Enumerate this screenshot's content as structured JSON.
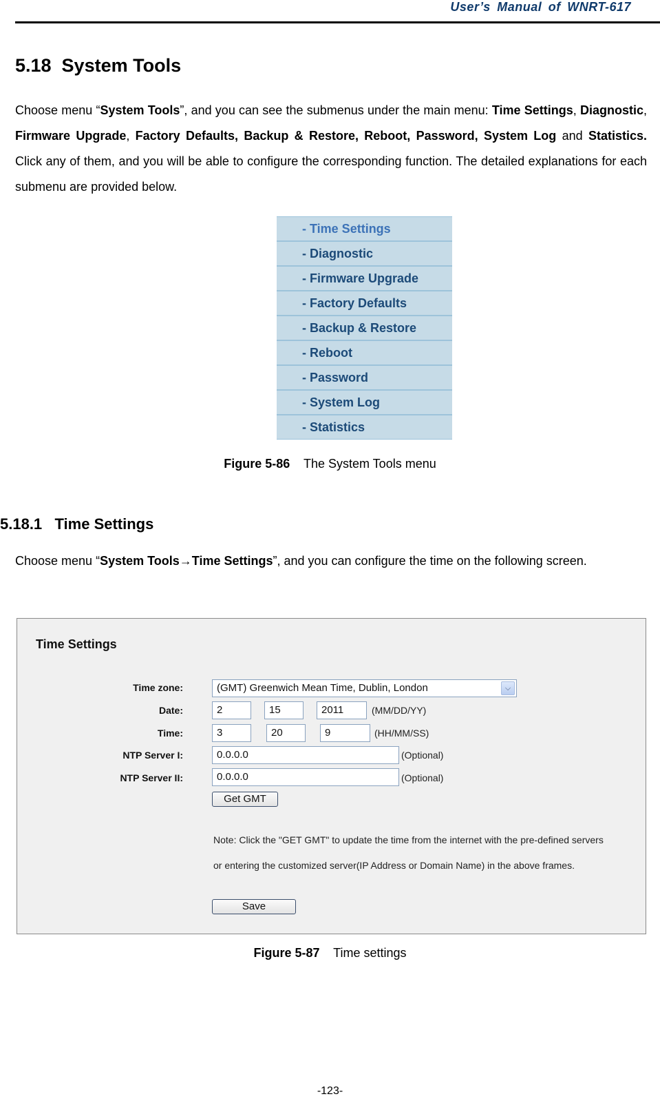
{
  "header": {
    "title": "User’s  Manual  of  WNRT-617"
  },
  "section": {
    "number": "5.18",
    "title": "System Tools",
    "heading": "5.18  System Tools"
  },
  "intro_paragraph": {
    "p1_prefix": "Choose menu “",
    "p1_bold1": "System Tools",
    "p1_mid": "”, and you can see the submenus under the main menu: ",
    "bold_items": [
      "Time Settings",
      "Diagnostic",
      "Firmware Upgrade",
      "Factory Defaults, Backup & Restore, Reboot, Password,",
      "System Log",
      "Statistics."
    ],
    "sep_comma": ", ",
    "and_word": " and ",
    "tail": " Click any of them, and you will be able to configure the corresponding function. The detailed explanations for each submenu are provided below."
  },
  "menu": {
    "items": [
      {
        "label": "- Time Settings",
        "active": true
      },
      {
        "label": "- Diagnostic"
      },
      {
        "label": "- Firmware Upgrade"
      },
      {
        "label": "- Factory Defaults"
      },
      {
        "label": "- Backup & Restore"
      },
      {
        "label": "- Reboot"
      },
      {
        "label": "- Password"
      },
      {
        "label": "- System Log"
      },
      {
        "label": "- Statistics"
      }
    ]
  },
  "figure1": {
    "label": "Figure 5-86",
    "text": "    The System Tools menu"
  },
  "subsection": {
    "heading": "5.18.1   Time Settings"
  },
  "sub_paragraph": {
    "prefix": "Choose  menu  “",
    "bold": "System Tools→Time Settings",
    "suffix": "”,  and  you  can  configure  the  time  on  the  following screen."
  },
  "time_settings": {
    "title": "Time Settings",
    "labels": {
      "time_zone": "Time zone:",
      "date": "Date:",
      "time": "Time:",
      "ntp1": "NTP Server I:",
      "ntp2": "NTP Server II:"
    },
    "time_zone_value": "(GMT) Greenwich Mean Time, Dublin, London",
    "date": {
      "month": "2",
      "day": "15",
      "year": "2011",
      "format_hint": "(MM/DD/YY)"
    },
    "time": {
      "hour": "3",
      "minute": "20",
      "second": "9",
      "format_hint": "(HH/MM/SS)"
    },
    "ntp1": {
      "value": "0.0.0.0",
      "hint": "(Optional)"
    },
    "ntp2": {
      "value": "0.0.0.0",
      "hint": "(Optional)"
    },
    "get_gmt_label": "Get GMT",
    "note_line1": "Note: Click the \"GET GMT\" to update the time from the internet with the pre-defined servers",
    "note_line2": "or entering the customized server(IP Address or Domain Name) in the above frames.",
    "save_label": "Save"
  },
  "figure2": {
    "label": "Figure 5-87",
    "text": "    Time settings"
  },
  "footer": {
    "page_number": "-123-"
  }
}
